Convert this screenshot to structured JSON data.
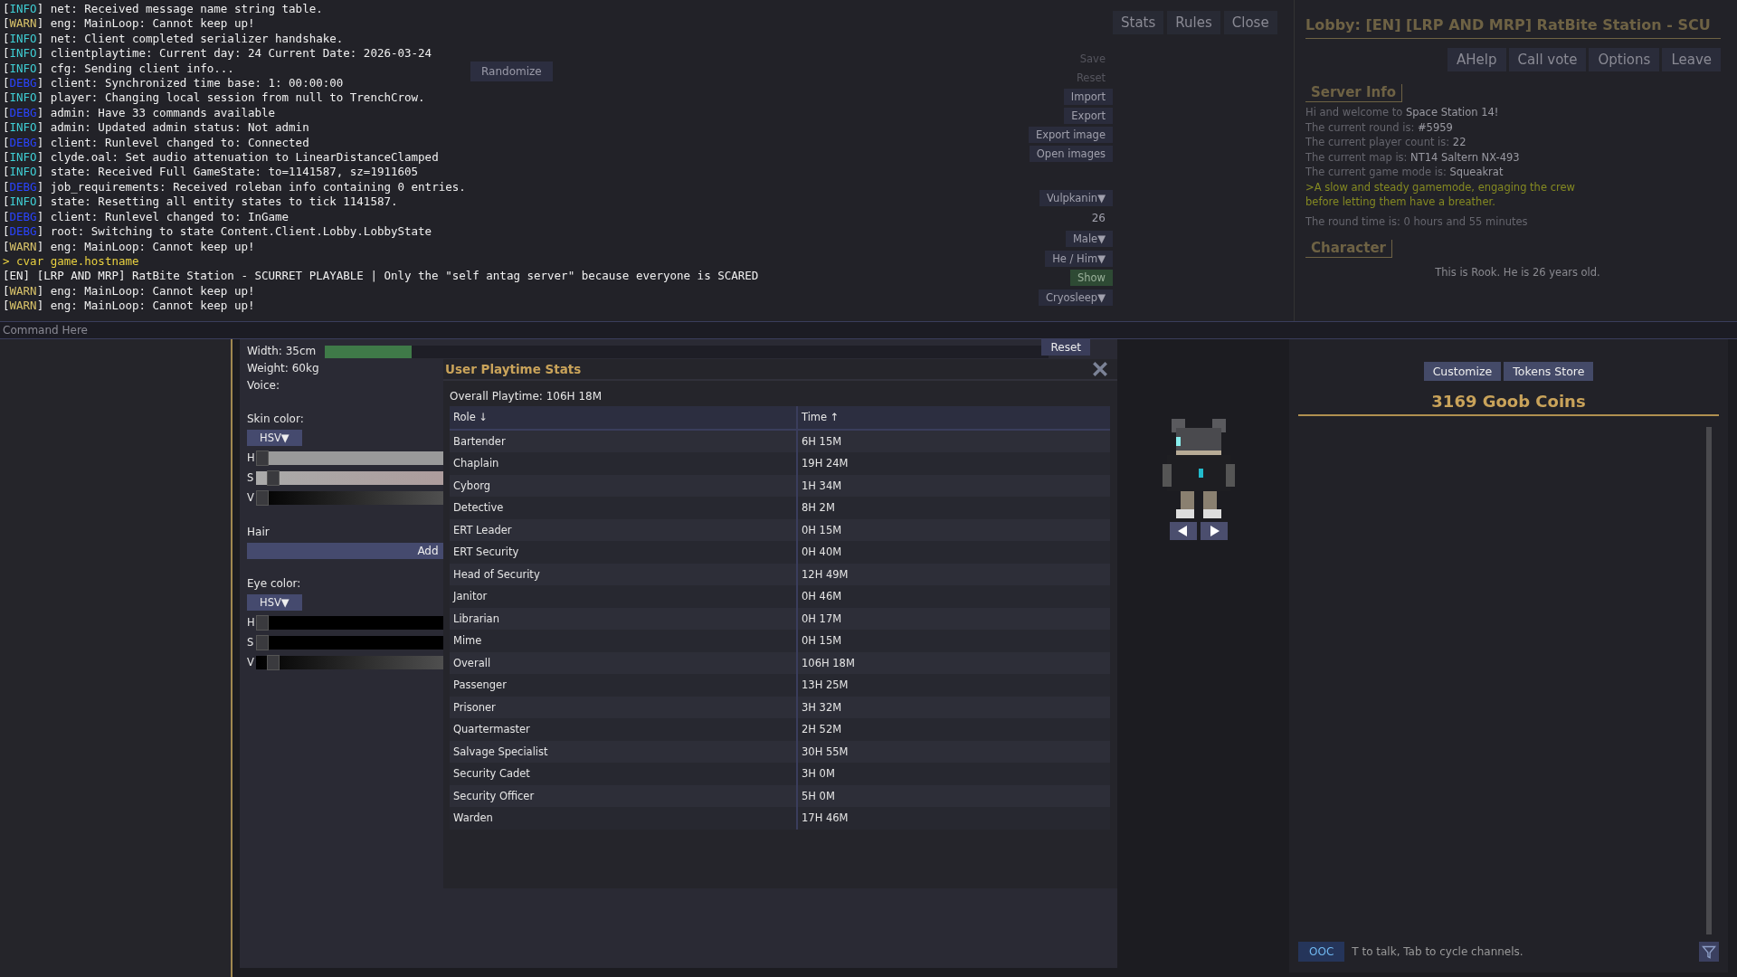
{
  "console": {
    "lines": [
      {
        "kind": "info",
        "tag": "[INFO]",
        "text": "net: Received message name string table."
      },
      {
        "kind": "warn",
        "tag": "[WARN]",
        "text": "eng: MainLoop: Cannot keep up!"
      },
      {
        "kind": "info",
        "tag": "[INFO]",
        "text": "net: Client completed serializer handshake."
      },
      {
        "kind": "info",
        "tag": "[INFO]",
        "text": "clientplaytime: Current day: 24 Current Date: 2026-03-24"
      },
      {
        "kind": "info",
        "tag": "[INFO]",
        "text": "cfg: Sending client info..."
      },
      {
        "kind": "debug",
        "tag": "[DEBG]",
        "text": "client: Synchronized time base: 1: 00:00:00"
      },
      {
        "kind": "info",
        "tag": "[INFO]",
        "text": "player: Changing local session from null to TrenchCrow."
      },
      {
        "kind": "debug",
        "tag": "[DEBG]",
        "text": "admin: Have 33 commands available"
      },
      {
        "kind": "info",
        "tag": "[INFO]",
        "text": "admin: Updated admin status: Not admin"
      },
      {
        "kind": "debug",
        "tag": "[DEBG]",
        "text": "client: Runlevel changed to: Connected"
      },
      {
        "kind": "info",
        "tag": "[INFO]",
        "text": "clyde.oal: Set audio attenuation to LinearDistanceClamped"
      },
      {
        "kind": "info",
        "tag": "[INFO]",
        "text": "state: Received Full GameState: to=1141587, sz=1911605"
      },
      {
        "kind": "debug",
        "tag": "[DEBG]",
        "text": "job_requirements: Received roleban info containing 0 entries."
      },
      {
        "kind": "info",
        "tag": "[INFO]",
        "text": "state: Resetting all entity states to tick 1141587."
      },
      {
        "kind": "debug",
        "tag": "[DEBG]",
        "text": "client: Runlevel changed to: InGame"
      },
      {
        "kind": "debug",
        "tag": "[DEBG]",
        "text": "root: Switching to state Content.Client.Lobby.LobbyState"
      },
      {
        "kind": "warn",
        "tag": "[WARN]",
        "text": "eng: MainLoop: Cannot keep up!"
      },
      {
        "kind": "command",
        "text": "> cvar game.hostname"
      },
      {
        "kind": "output",
        "text": "[EN] [LRP AND MRP] RatBite Station - SCURRET PLAYABLE | Only the \"self antag server\" because everyone is SCARED"
      },
      {
        "kind": "warn",
        "tag": "[WARN]",
        "text": "eng: MainLoop: Cannot keep up!"
      },
      {
        "kind": "warn",
        "tag": "[WARN]",
        "text": "eng: MainLoop: Cannot keep up!"
      }
    ],
    "placeholder": "Command Here"
  },
  "top_buttons": [
    "Stats",
    "Rules",
    "Close"
  ],
  "setup": {
    "randomize": "Randomize",
    "actions": [
      {
        "label": "Save",
        "disabled": true
      },
      {
        "label": "Reset",
        "disabled": true
      },
      {
        "label": "Import",
        "disabled": false
      },
      {
        "label": "Export",
        "disabled": false
      },
      {
        "label": "Export image",
        "disabled": false
      },
      {
        "label": "Open images",
        "disabled": false
      }
    ],
    "fields": [
      {
        "kind": "dropdown",
        "value": "Vulpkanin▼"
      },
      {
        "kind": "value",
        "value": "26"
      },
      {
        "kind": "dropdown",
        "value": "Male▼"
      },
      {
        "kind": "dropdown",
        "value": "He / Him▼"
      },
      {
        "kind": "toggle",
        "value": "Show"
      },
      {
        "kind": "dropdown",
        "value": "Cryosleep▼"
      }
    ]
  },
  "lobby": {
    "title": "Lobby: [EN] [LRP AND MRP] RatBite Station - SCU",
    "buttons": [
      "AHelp",
      "Call vote",
      "Options",
      "Leave"
    ],
    "server_info_heading": "Server Info",
    "server_info": [
      {
        "label": "Hi and welcome to ",
        "value": "Space Station 14!"
      },
      {
        "label": "The current round is: ",
        "value": "#5959"
      },
      {
        "label": "The current player count is: ",
        "value": "22"
      },
      {
        "label": "The current map is: ",
        "value": "NT14 Saltern NX-493"
      },
      {
        "label": "The current game mode is: ",
        "value": "Squeakrat"
      }
    ],
    "mode_description": ">A slow and steady gamemode, engaging the crew before letting them have a breather.",
    "round_time": "The round time is: 0 hours and 55 minutes",
    "character_heading": "Character",
    "character_summary": "This is Rook. He is 26 years old.",
    "character_buttons": [
      "Customize",
      "Tokens Store"
    ],
    "coins": "3169 Goob Coins",
    "chat": {
      "channel": "OOC",
      "placeholder": "T to talk, Tab to cycle channels."
    }
  },
  "editor": {
    "width": "Width: 35cm",
    "width_slider": {
      "level": 0.12
    },
    "reset": "Reset",
    "weight": "Weight: 60kg",
    "voice": "Voice:",
    "skin_color": {
      "label": "Skin color:",
      "mode": "HSV▼",
      "sliders": [
        {
          "label": "H",
          "level": 0
        },
        {
          "label": "S",
          "level": 0.03
        },
        {
          "label": "V",
          "level": 0
        }
      ]
    },
    "hair": {
      "label": "Hair",
      "button": "Add"
    },
    "eye_color": {
      "label": "Eye color:",
      "mode": "HSV▼",
      "sliders": [
        {
          "label": "H",
          "level": 0
        },
        {
          "label": "S",
          "level": 0
        },
        {
          "label": "V",
          "level": 0.03
        }
      ]
    }
  },
  "playtime": {
    "title": "User Playtime Stats",
    "overall": "Overall Playtime: 106H 18M",
    "columns": [
      "Role ↓",
      "Time ↑"
    ],
    "rows": [
      [
        "Bartender",
        "6H 15M"
      ],
      [
        "Chaplain",
        "19H 24M"
      ],
      [
        "Cyborg",
        "1H 34M"
      ],
      [
        "Detective",
        "8H 2M"
      ],
      [
        "ERT Leader",
        "0H 15M"
      ],
      [
        "ERT Security",
        "0H 40M"
      ],
      [
        "Head of Security",
        "12H 49M"
      ],
      [
        "Janitor",
        "0H 46M"
      ],
      [
        "Librarian",
        "0H 17M"
      ],
      [
        "Mime",
        "0H 15M"
      ],
      [
        "Overall",
        "106H 18M"
      ],
      [
        "Passenger",
        "13H 25M"
      ],
      [
        "Prisoner",
        "3H 32M"
      ],
      [
        "Quartermaster",
        "2H 52M"
      ],
      [
        "Salvage Specialist",
        "30H 55M"
      ],
      [
        "Security Cadet",
        "3H 0M"
      ],
      [
        "Security Officer",
        "5H 0M"
      ],
      [
        "Warden",
        "17H 46M"
      ]
    ]
  }
}
